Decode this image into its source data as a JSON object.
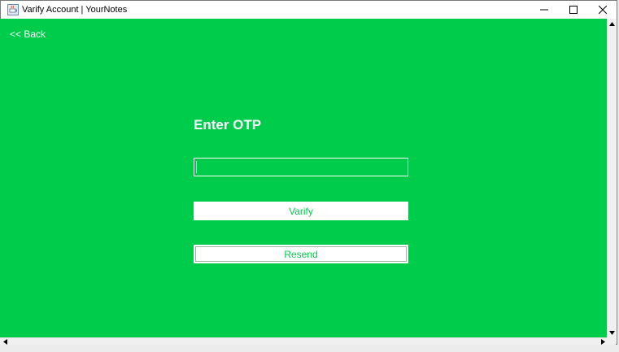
{
  "window": {
    "title": "Varify Account | YourNotes",
    "app_icon": "java-cup-icon",
    "controls": {
      "minimize_icon": "minimize-icon",
      "maximize_icon": "maximize-icon",
      "close_icon": "close-icon"
    }
  },
  "page": {
    "back_label": "<< Back",
    "heading": "Enter OTP",
    "otp_field": {
      "value": "",
      "placeholder": ""
    },
    "verify_label": "Varify",
    "resend_label": "Resend"
  },
  "colors": {
    "accent_green": "#00cc4c",
    "text_white": "#ffffff"
  }
}
